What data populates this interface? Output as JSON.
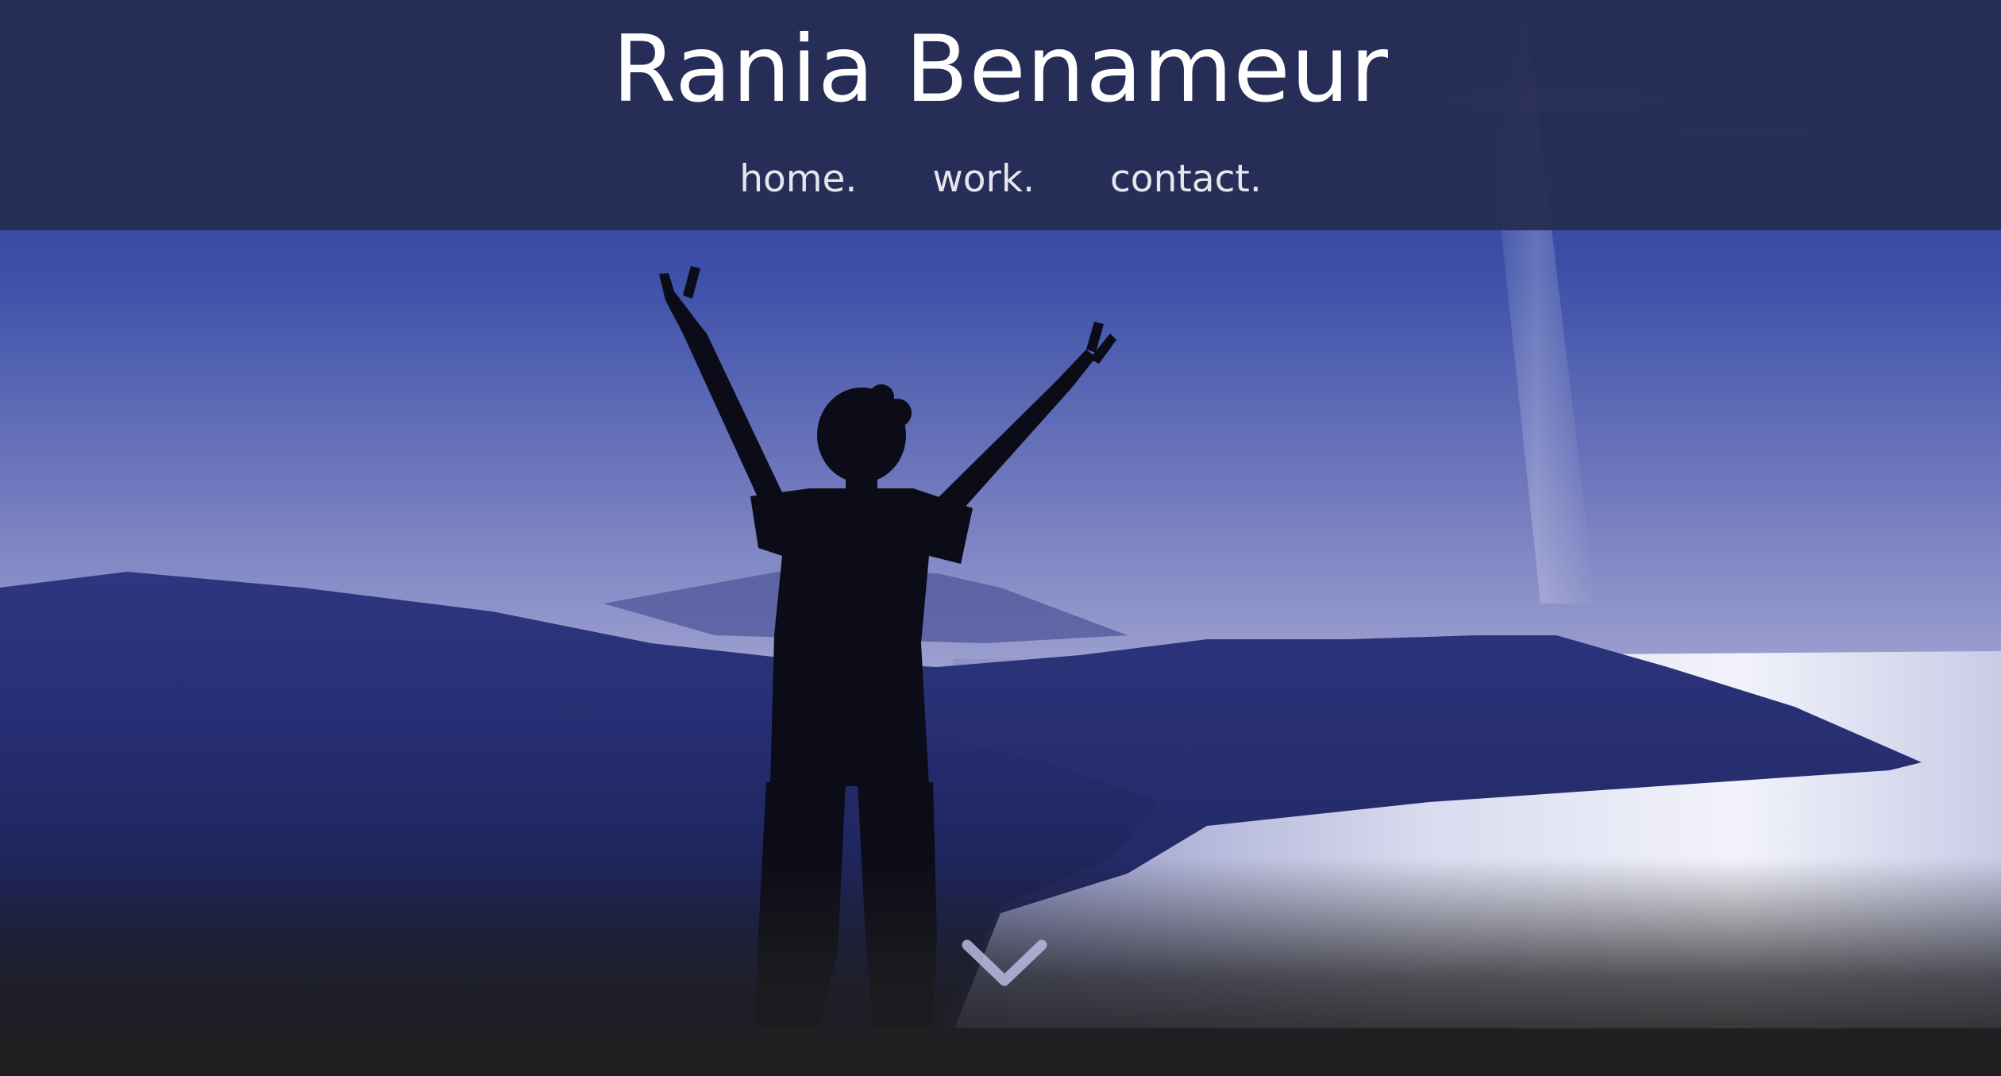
{
  "site": {
    "title": "Rania Benameur"
  },
  "nav": {
    "items": [
      {
        "label": "home."
      },
      {
        "label": "work."
      },
      {
        "label": "contact."
      }
    ]
  },
  "hero": {
    "scroll_icon": "chevron-down-icon"
  },
  "colors": {
    "header_bg": "#262c52",
    "title_text": "#ffffff",
    "nav_text": "#e6e6ee",
    "sky_top": "#3a4fa6",
    "sky_bottom": "#9a9ccc",
    "mountains": "#222a66",
    "sea_glow": "#eef0fa",
    "footer_bg": "#1f1f21"
  }
}
